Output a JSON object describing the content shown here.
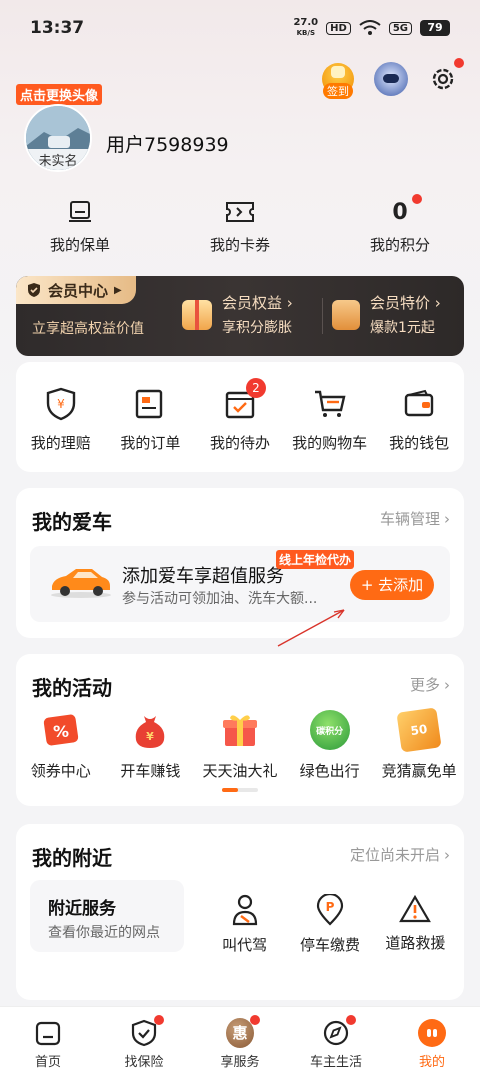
{
  "status_bar": {
    "time": "13:37",
    "speed_value": "27.0",
    "speed_unit": "KB/S",
    "hd": "HD",
    "signal": "5G",
    "battery": "79"
  },
  "header": {
    "checkin_label": "签到",
    "avatar_tag": "点击更换头像",
    "avatar_label": "未实名",
    "username": "用户7598939"
  },
  "quick": [
    {
      "label": "我的保单",
      "icon": "policy-icon"
    },
    {
      "label": "我的卡券",
      "icon": "coupon-icon"
    },
    {
      "label": "我的积分",
      "value": "0"
    }
  ],
  "member": {
    "center_label": "会员中心",
    "subtitle": "立享超高权益价值",
    "benefit_title": "会员权益 ›",
    "benefit_sub": "享积分膨胀",
    "deal_title": "会员特价 ›",
    "deal_sub": "爆款1元起"
  },
  "services": [
    {
      "label": "我的理赔",
      "icon": "shield-yen-icon"
    },
    {
      "label": "我的订单",
      "icon": "order-icon"
    },
    {
      "label": "我的待办",
      "icon": "todo-icon",
      "badge": "2"
    },
    {
      "label": "我的购物车",
      "icon": "cart-icon"
    },
    {
      "label": "我的钱包",
      "icon": "wallet-icon"
    }
  ],
  "car": {
    "title": "我的爱车",
    "manage": "车辆管理",
    "add_title": "添加爱车享超值服务",
    "add_sub": "参与活动可领加油、洗车大额...",
    "tag": "线上年检代办",
    "add_button": "+ 去添加"
  },
  "activities": {
    "title": "我的活动",
    "more": "更多",
    "items": [
      {
        "label": "领券中心",
        "icon": "percent-coupon-icon"
      },
      {
        "label": "开车赚钱",
        "icon": "money-bag-icon"
      },
      {
        "label": "天天油大礼",
        "icon": "gift-box-icon"
      },
      {
        "label": "绿色出行",
        "icon": "carbon-points-icon",
        "icon_text": "碳积分"
      },
      {
        "label": "竞猜赢免单",
        "icon": "voucher-icon",
        "icon_text": "50"
      }
    ]
  },
  "nearby": {
    "title": "我的附近",
    "location_status": "定位尚未开启",
    "box_title": "附近服务",
    "box_sub": "查看你最近的网点",
    "items": [
      {
        "label": "叫代驾",
        "icon": "driver-icon"
      },
      {
        "label": "停车缴费",
        "icon": "parking-icon"
      },
      {
        "label": "道路救援",
        "icon": "warning-icon"
      }
    ]
  },
  "tabbar": [
    {
      "label": "首页",
      "icon": "home-icon"
    },
    {
      "label": "找保险",
      "icon": "shield-check-icon"
    },
    {
      "label": "享服务",
      "icon": "hui-icon",
      "icon_text": "惠"
    },
    {
      "label": "车主生活",
      "icon": "compass-icon"
    },
    {
      "label": "我的",
      "icon": "me-icon",
      "active": true
    }
  ],
  "colors": {
    "accent": "#ff6a14",
    "badge": "#f13a2f",
    "member_bg": "#2f2b2b",
    "member_text": "#f3d6b4"
  }
}
